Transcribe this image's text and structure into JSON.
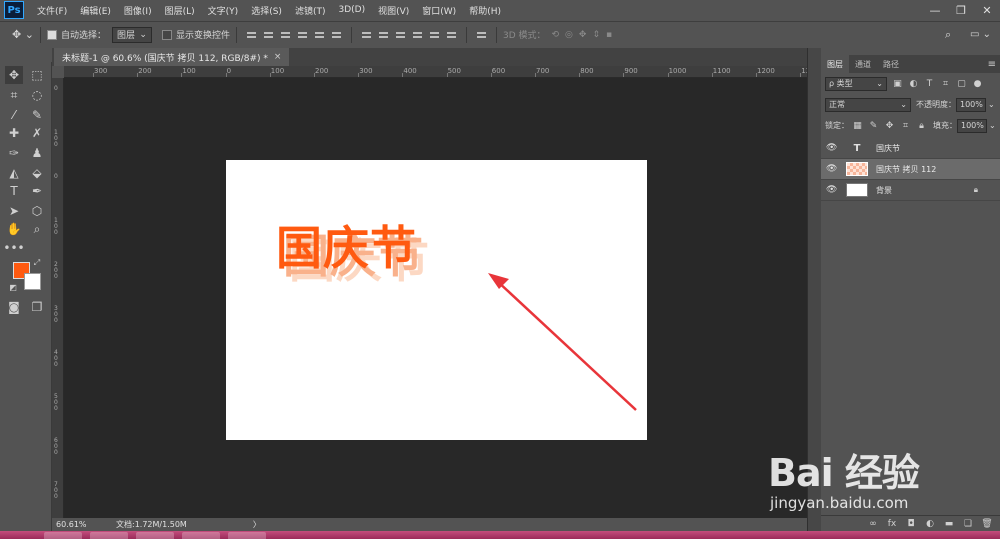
{
  "app": {
    "logo": "Ps"
  },
  "menu": [
    "文件(F)",
    "编辑(E)",
    "图像(I)",
    "图层(L)",
    "文字(Y)",
    "选择(S)",
    "滤镜(T)",
    "3D(D)",
    "视图(V)",
    "窗口(W)",
    "帮助(H)"
  ],
  "window_controls": {
    "minimize": "—",
    "restore": "❐",
    "close": "✕"
  },
  "options": {
    "auto_select_label": "自动选择：",
    "auto_select_checked": true,
    "target_value": "图层",
    "show_transform_label": "显示变换控件",
    "show_transform_checked": false,
    "mode_3d_label": "3D 模式："
  },
  "document_tab": {
    "title": "未标题-1 @ 60.6% (国庆节 拷贝 112, RGB/8#) *",
    "close": "×"
  },
  "ruler_top_labels": [
    "300",
    "200",
    "100",
    "0",
    "100",
    "200",
    "300",
    "400",
    "500",
    "600",
    "700",
    "800",
    "900",
    "1000",
    "1100",
    "1200",
    "1300"
  ],
  "ruler_left_labels": [
    "0",
    "100",
    "0",
    "100",
    "200",
    "300",
    "400",
    "500",
    "600",
    "700"
  ],
  "canvas": {
    "text": "国庆节",
    "text_color": "#ff5a10",
    "arrow_color": "#e8353a"
  },
  "status": {
    "zoom": "60.61%",
    "doc_info": "文档:1.72M/1.50M",
    "arrow": "〉"
  },
  "panel": {
    "tabs": [
      "图层",
      "通道",
      "路径"
    ],
    "filter_kind": "ρ 类型",
    "blend_mode": "正常",
    "opacity_label": "不透明度：",
    "opacity_value": "100%",
    "lock_label": "锁定：",
    "fill_label": "填充：",
    "fill_value": "100%",
    "layers": [
      {
        "name": "国庆节",
        "type": "text",
        "visible": true,
        "selected": false
      },
      {
        "name": "国庆节 拷贝 112",
        "type": "raster",
        "visible": true,
        "selected": true
      },
      {
        "name": "背景",
        "type": "background",
        "visible": true,
        "selected": false,
        "locked": true
      }
    ]
  },
  "colors": {
    "foreground": "#ff5a10",
    "background": "#ffffff"
  },
  "watermark": {
    "logo": "Bai 经验",
    "url": "jingyan.baidu.com"
  }
}
